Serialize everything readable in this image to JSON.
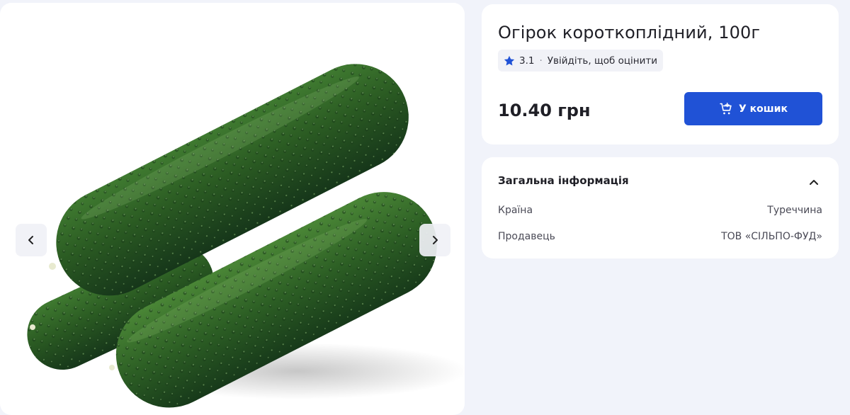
{
  "product": {
    "title": "Огірок короткоплідний, 100г",
    "rating": {
      "value": "3.1",
      "separator": "·",
      "login_prompt": "Увійдіть, щоб оцінити"
    },
    "price": "10.40 грн",
    "add_to_cart_label": "У кошик"
  },
  "info": {
    "section_title": "Загальна інформація",
    "rows": [
      {
        "label": "Країна",
        "value": "Туреччина"
      },
      {
        "label": "Продавець",
        "value": "ТОВ «СІЛЬПО-ФУД»"
      }
    ]
  },
  "icons": {
    "star": "star-icon",
    "cart": "cart-plus-icon",
    "chevron_up": "chevron-up-icon",
    "prev": "chevron-left-icon",
    "next": "chevron-right-icon"
  },
  "colors": {
    "accent": "#2052d6",
    "star": "#2052d6",
    "page_bg": "#f1f3fa",
    "cucumber_dark": "#1f4a1e",
    "cucumber_light": "#4f8a3a"
  }
}
